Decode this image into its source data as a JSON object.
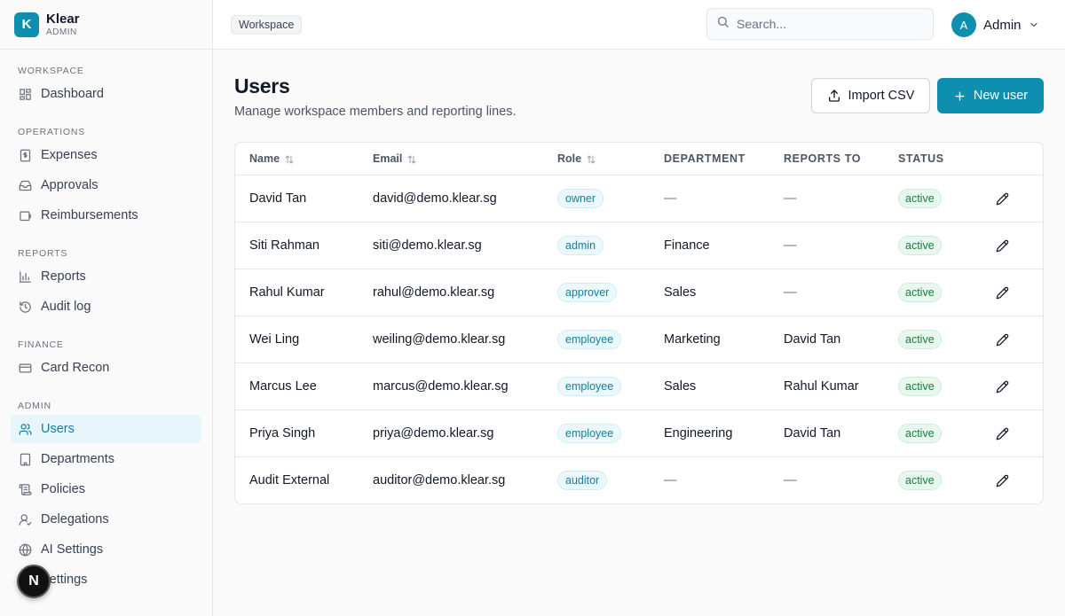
{
  "brand": {
    "logo_letter": "K",
    "name": "Klear",
    "subtitle": "ADMIN",
    "color": "#0e8fb0"
  },
  "sidebar": {
    "sections": [
      {
        "label": "WORKSPACE",
        "items": [
          {
            "label": "Dashboard",
            "icon": "dashboard-icon"
          }
        ]
      },
      {
        "label": "OPERATIONS",
        "items": [
          {
            "label": "Expenses",
            "icon": "receipt-icon"
          },
          {
            "label": "Approvals",
            "icon": "inbox-icon"
          },
          {
            "label": "Reimbursements",
            "icon": "wallet-icon"
          }
        ]
      },
      {
        "label": "REPORTS",
        "items": [
          {
            "label": "Reports",
            "icon": "bar-chart-icon"
          },
          {
            "label": "Audit log",
            "icon": "history-icon"
          }
        ]
      },
      {
        "label": "FINANCE",
        "items": [
          {
            "label": "Card Recon",
            "icon": "credit-card-icon"
          }
        ]
      },
      {
        "label": "ADMIN",
        "items": [
          {
            "label": "Users",
            "icon": "users-icon",
            "active": true
          },
          {
            "label": "Departments",
            "icon": "building-icon"
          },
          {
            "label": "Policies",
            "icon": "scroll-icon"
          },
          {
            "label": "Delegations",
            "icon": "user-check-icon"
          },
          {
            "label": "AI Settings",
            "icon": "globe-icon"
          },
          {
            "label": "Settings",
            "icon": "gear-icon"
          }
        ]
      }
    ]
  },
  "floating_button": {
    "label": "N"
  },
  "topbar": {
    "breadcrumb": "Workspace",
    "search": {
      "placeholder": "Search...",
      "value": ""
    },
    "user": {
      "avatar_letter": "A",
      "name": "Admin"
    }
  },
  "page": {
    "title": "Users",
    "subtitle": "Manage workspace members and reporting lines.",
    "import_label": "Import CSV",
    "new_label": "New user"
  },
  "table": {
    "headers": {
      "name": "Name",
      "email": "Email",
      "role": "Role",
      "department": "DEPARTMENT",
      "reports_to": "REPORTS TO",
      "status": "STATUS"
    },
    "rows": [
      {
        "name": "David Tan",
        "email": "david@demo.klear.sg",
        "role": "owner",
        "department": "—",
        "reports_to": "—",
        "status": "active"
      },
      {
        "name": "Siti Rahman",
        "email": "siti@demo.klear.sg",
        "role": "admin",
        "department": "Finance",
        "reports_to": "—",
        "status": "active"
      },
      {
        "name": "Rahul Kumar",
        "email": "rahul@demo.klear.sg",
        "role": "approver",
        "department": "Sales",
        "reports_to": "—",
        "status": "active"
      },
      {
        "name": "Wei Ling",
        "email": "weiling@demo.klear.sg",
        "role": "employee",
        "department": "Marketing",
        "reports_to": "David Tan",
        "status": "active"
      },
      {
        "name": "Marcus Lee",
        "email": "marcus@demo.klear.sg",
        "role": "employee",
        "department": "Sales",
        "reports_to": "Rahul Kumar",
        "status": "active"
      },
      {
        "name": "Priya Singh",
        "email": "priya@demo.klear.sg",
        "role": "employee",
        "department": "Engineering",
        "reports_to": "David Tan",
        "status": "active"
      },
      {
        "name": "Audit External",
        "email": "auditor@demo.klear.sg",
        "role": "auditor",
        "department": "—",
        "reports_to": "—",
        "status": "active"
      }
    ]
  }
}
